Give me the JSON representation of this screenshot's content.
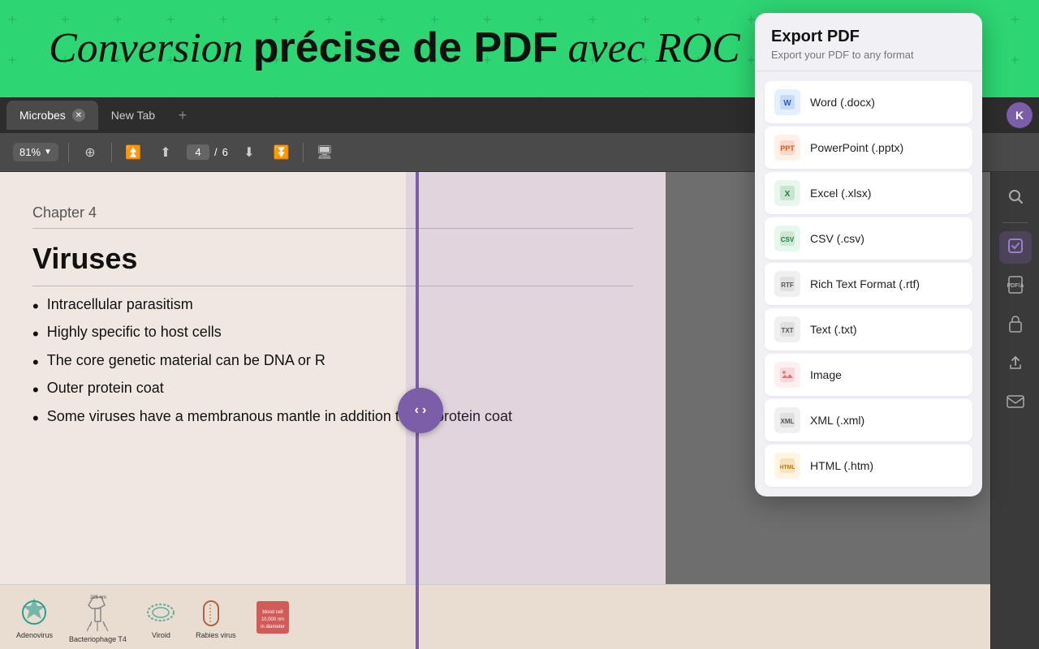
{
  "banner": {
    "text_part1": "Conversion",
    "text_part2": "précise de PDF",
    "text_part3": "avec ROC",
    "arrow": "➘"
  },
  "tabs": [
    {
      "label": "Microbes",
      "active": true
    },
    {
      "label": "New Tab",
      "active": false
    }
  ],
  "toolbar": {
    "zoom": "81%",
    "current_page": "4",
    "total_pages": "6"
  },
  "pdf": {
    "chapter": "Chapter 4",
    "section_title": "Viruses",
    "bullets": [
      "Intracellular parasitism",
      "Highly specific to host cells",
      "The core genetic material can be DNA or R",
      "Outer protein coat",
      "Some viruses have a membranous mantle in addition to the protein coat"
    ]
  },
  "export_panel": {
    "title": "Export PDF",
    "subtitle": "Export your PDF to any format",
    "formats": [
      {
        "label": "Word (.docx)",
        "icon_type": "word"
      },
      {
        "label": "PowerPoint (.pptx)",
        "icon_type": "ppt"
      },
      {
        "label": "Excel (.xlsx)",
        "icon_type": "excel"
      },
      {
        "label": "CSV (.csv)",
        "icon_type": "csv"
      },
      {
        "label": "Rich Text Format (.rtf)",
        "icon_type": "rtf"
      },
      {
        "label": "Text (.txt)",
        "icon_type": "txt"
      },
      {
        "label": "Image",
        "icon_type": "img"
      },
      {
        "label": "XML (.xml)",
        "icon_type": "xml"
      },
      {
        "label": "HTML (.htm)",
        "icon_type": "html"
      }
    ]
  },
  "sidebar": {
    "icons": [
      {
        "name": "search",
        "symbol": "🔍",
        "active": false
      },
      {
        "name": "convert",
        "symbol": "🔄",
        "active": true
      },
      {
        "name": "pdf-a",
        "symbol": "📄",
        "active": false
      },
      {
        "name": "protect",
        "symbol": "🔒",
        "active": false
      },
      {
        "name": "share",
        "symbol": "⬆",
        "active": false
      },
      {
        "name": "mail",
        "symbol": "✉",
        "active": false
      }
    ]
  },
  "avatar": {
    "letter": "K",
    "color": "#7b5ea7"
  }
}
